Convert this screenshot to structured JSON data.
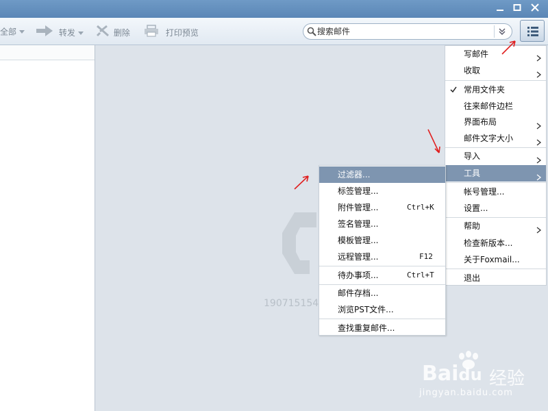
{
  "titlebar": {
    "minimize_icon": "minimize-icon",
    "maximize_icon": "maximize-icon",
    "close_icon": "close-icon"
  },
  "toolbar": {
    "reply_all_label": "全部",
    "forward_label": "转发",
    "delete_label": "删除",
    "print_preview_label": "打印预览",
    "search_placeholder": "搜索邮件",
    "menu_icon": "list-menu-icon"
  },
  "account_text": "190715154",
  "main_menu": {
    "items": [
      {
        "label": "写邮件",
        "submenu": true
      },
      {
        "label": "收取",
        "submenu": true
      },
      {
        "label": "常用文件夹",
        "checked": true
      },
      {
        "label": "往来邮件边栏"
      },
      {
        "label": "界面布局",
        "submenu": true
      },
      {
        "label": "邮件文字大小",
        "submenu": true
      },
      {
        "label": "导入",
        "submenu": true
      },
      {
        "label": "工具",
        "submenu": true,
        "highlighted": true
      },
      {
        "label": "帐号管理..."
      },
      {
        "label": "设置..."
      },
      {
        "label": "帮助",
        "submenu": true
      },
      {
        "label": "检查新版本..."
      },
      {
        "label": "关于Foxmail..."
      },
      {
        "label": "退出"
      }
    ]
  },
  "tools_submenu": {
    "items": [
      {
        "label": "过滤器...",
        "highlighted": true
      },
      {
        "label": "标签管理..."
      },
      {
        "label": "附件管理...",
        "shortcut": "Ctrl+K"
      },
      {
        "label": "签名管理..."
      },
      {
        "label": "模板管理..."
      },
      {
        "label": "远程管理...",
        "shortcut": "F12"
      },
      {
        "label": "待办事项...",
        "shortcut": "Ctrl+T"
      },
      {
        "label": "邮件存档..."
      },
      {
        "label": "浏览PST文件..."
      },
      {
        "label": "查找重复邮件..."
      }
    ]
  },
  "watermark": {
    "brand": "Bai",
    "brand_suffix": "du",
    "brand_cn": "经验",
    "url": "jingyan.baidu.com"
  },
  "colors": {
    "titlebar": "#5a86b6",
    "highlight": "#7e95b0",
    "annotation": "#e02020"
  }
}
